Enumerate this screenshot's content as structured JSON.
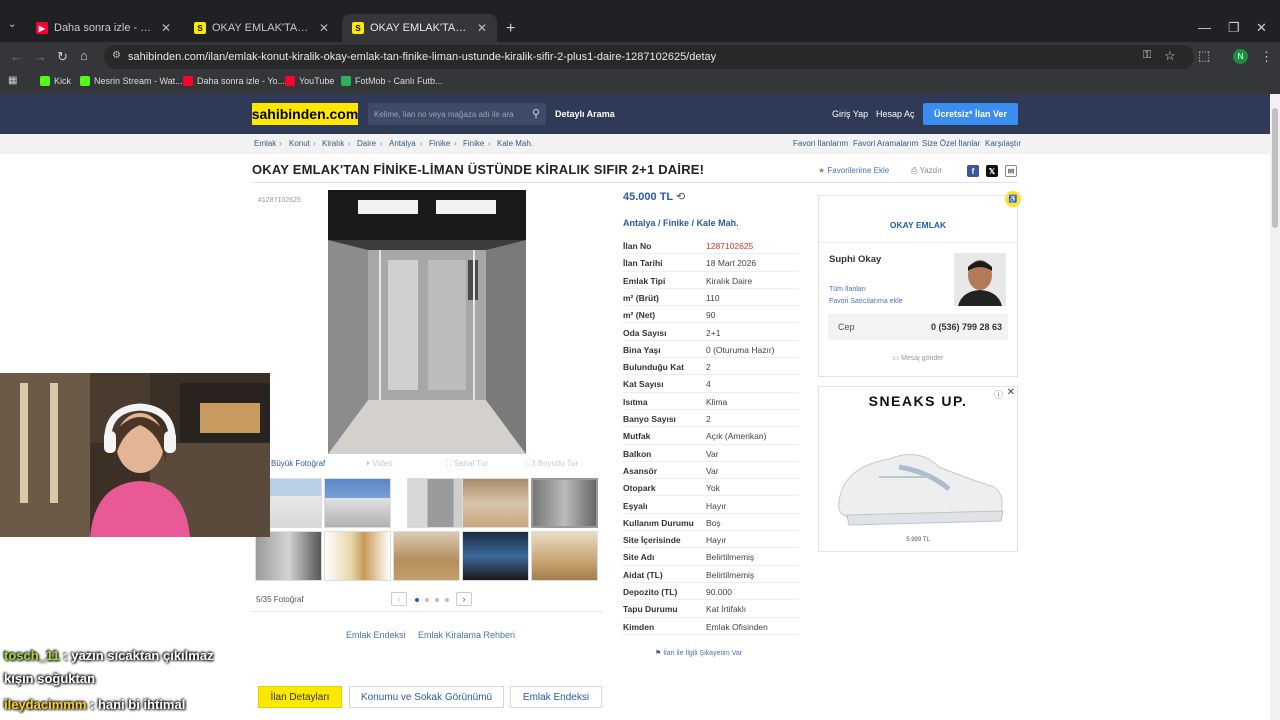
{
  "browser": {
    "tabs": [
      {
        "title": "Daha sonra izle - YouTube",
        "icon": "youtube-icon"
      },
      {
        "title": "OKAY EMLAK'TAN FİNİKE-LİMAN",
        "icon": "sahibinden-icon"
      },
      {
        "title": "OKAY EMLAK'TAN FİNİKE-LİMAN",
        "icon": "sahibinden-icon"
      }
    ],
    "new_tab": "+",
    "url": "sahibinden.com/ilan/emlak-konut-kiralik-okay-emlak-tan-finike-liman-ustunde-kiralik-sifir-2-plus1-daire-1287102625/detay",
    "profile_initial": "N",
    "bookmarks": [
      {
        "label": "Kick"
      },
      {
        "label": "Nesrin Stream - Wat..."
      },
      {
        "label": "Daha sonra izle - Yo..."
      },
      {
        "label": "YouTube"
      },
      {
        "label": "FotMob - Canlı Futb..."
      }
    ]
  },
  "site": {
    "logo": "sahibinden.com",
    "search_placeholder": "Kelime, ilan no veya mağaza adı ile ara",
    "detailed_search": "Detaylı Arama",
    "login": "Giriş Yap",
    "register": "Hesap Aç",
    "post_ad": "Ücretsiz* İlan Ver",
    "accent": "#ffe800",
    "header_bg": "#2f3b56"
  },
  "breadcrumb": [
    "Emlak",
    "Konut",
    "Kiralık",
    "Daire",
    "Antalya",
    "Finike",
    "Finike",
    "Kale Mah."
  ],
  "top_links": [
    "Favori İlanlarım",
    "Favori Aramalarım",
    "Size Özel İlanlar",
    "Karşılaştır"
  ],
  "listing": {
    "title": "OKAY EMLAK'TAN FİNİKE-LİMAN ÜSTÜNDE KİRALIK SIFIR 2+1 DAİRE!",
    "favorite": "Favorilerime Ekle",
    "print": "Yazdır",
    "small_id": "#1287102625",
    "price": "45.000 TL",
    "location": [
      "Antalya",
      "Finike",
      "Kale Mah."
    ],
    "details": [
      {
        "k": "İlan No",
        "v": "1287102625"
      },
      {
        "k": "İlan Tarihi",
        "v": "18 Mart 2026"
      },
      {
        "k": "Emlak Tipi",
        "v": "Kiralık Daire"
      },
      {
        "k": "m² (Brüt)",
        "v": "110"
      },
      {
        "k": "m² (Net)",
        "v": "90"
      },
      {
        "k": "Oda Sayısı",
        "v": "2+1"
      },
      {
        "k": "Bina Yaşı",
        "v": "0 (Oturuma Hazır)"
      },
      {
        "k": "Bulunduğu Kat",
        "v": "2"
      },
      {
        "k": "Kat Sayısı",
        "v": "4"
      },
      {
        "k": "Isıtma",
        "v": "Klima"
      },
      {
        "k": "Banyo Sayısı",
        "v": "2"
      },
      {
        "k": "Mutfak",
        "v": "Açık (Amerikan)"
      },
      {
        "k": "Balkon",
        "v": "Var"
      },
      {
        "k": "Asansör",
        "v": "Var"
      },
      {
        "k": "Otopark",
        "v": "Yok"
      },
      {
        "k": "Eşyalı",
        "v": "Hayır"
      },
      {
        "k": "Kullanım Durumu",
        "v": "Boş"
      },
      {
        "k": "Site İçerisinde",
        "v": "Hayır"
      },
      {
        "k": "Site Adı",
        "v": "Belirtilmemiş"
      },
      {
        "k": "Aidat (TL)",
        "v": "Belirtilmemiş"
      },
      {
        "k": "Depozito (TL)",
        "v": "90.000"
      },
      {
        "k": "Tapu Durumu",
        "v": "Kat İrtifaklı"
      },
      {
        "k": "Kimden",
        "v": "Emlak Ofisinden"
      }
    ],
    "complaint": "İlan ile İlgili Şikayetim Var"
  },
  "gallery": {
    "tabs": [
      "Büyük Fotoğraf",
      "Video",
      "Sanal Tur",
      "3 Boyutlu Tur"
    ],
    "count": "5/35 Fotoğraf",
    "below_links": [
      "Emlak Endeksi",
      "Emlak Kiralama Rehberi"
    ]
  },
  "seller": {
    "store": "OKAY EMLAK",
    "name": "Suphi Okay",
    "all_ads": "Tüm İlanları",
    "add_fav": "Favori Satıcılarıma ekle",
    "phone_label": "Cep",
    "phone": "0 (536) 799 28 63",
    "message": "Mesaj gönder"
  },
  "ad": {
    "brand": "SNEAKS UP.",
    "price": "5.999 TL"
  },
  "bottom_tabs": [
    "İlan Detayları",
    "Konumu ve Sokak Görünümü",
    "Emlak Endeksi"
  ],
  "chat": [
    {
      "user": "tosch_11",
      "msg": "yazın sıcaktan çıkılmaz"
    },
    {
      "user": "",
      "msg": "kışın soğuktan"
    },
    {
      "user": "ileydacimmm",
      "msg": "hani bi ihtimal"
    }
  ]
}
